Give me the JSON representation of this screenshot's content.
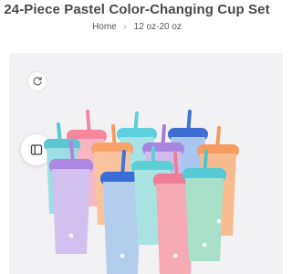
{
  "product": {
    "title": "24-Piece Pastel Color-Changing Cup Set"
  },
  "breadcrumb": {
    "home": "Home",
    "separator": "›",
    "current": "12 oz-20 oz"
  },
  "gallery": {
    "controls": {
      "rotate_icon": "rotate-360-icon",
      "sidebar_icon": "sidebar-panel-icon"
    },
    "image_alt": "Pastel color-changing cups with lids and straws"
  },
  "colors": {
    "background": "#ffffff",
    "gallery_bg": "#f2f2f4",
    "title": "#4a4a4a",
    "cup_blue": "#8fbde6",
    "cup_pink": "#f4a9b8",
    "cup_purple": "#c8a8e4",
    "cup_green": "#9fdcc4",
    "cup_orange": "#f6b58c",
    "cup_teal": "#84d6df"
  }
}
